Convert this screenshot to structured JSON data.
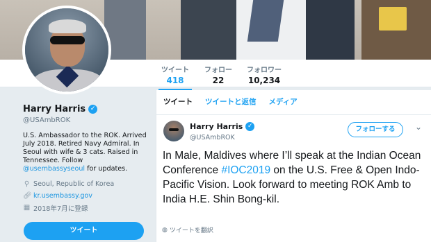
{
  "nav": {
    "stats": [
      {
        "label": "ツイート",
        "value": "418"
      },
      {
        "label": "フォロー",
        "value": "22"
      },
      {
        "label": "フォロワー",
        "value": "10,234"
      }
    ]
  },
  "profile": {
    "name": "Harry Harris",
    "handle": "@USAmbROK",
    "bio_text": "U.S. Ambassador to the ROK. Arrived July 2018. Retired Navy Admiral. In Seoul with wife & 3 cats. Raised in Tennessee. Follow ",
    "bio_link": "@usembassyseoul",
    "bio_end": " for updates.",
    "location": "Seoul, Republic of Korea",
    "website": "kr.usembassy.gov",
    "joined": "2018年7月に登録",
    "tweet_button": "ツイート"
  },
  "timeline": {
    "tabs": [
      "ツイート",
      "ツイートと返信",
      "メディア"
    ],
    "tweet": {
      "name": "Harry Harris",
      "handle": "@USAmbROK",
      "follow_label": "フォローする",
      "text_before": "In Male, Maldives where I’ll speak at the Indian Ocean Conference ",
      "hashtag": "#IOC2019",
      "text_after": " on the U.S. Free & Open Indo-Pacific Vision. Look forward to meeting ROK Amb to India H.E. Shin Bong-kil.",
      "translate_label": "ツイートを翻訳"
    }
  },
  "colors": {
    "accent": "#1da1f2",
    "link": "#1b95e0",
    "muted": "#657786"
  },
  "icons": {
    "verified": "verified-badge-icon",
    "location": "location-pin-icon",
    "link": "link-icon",
    "calendar": "calendar-icon",
    "globe": "globe-icon",
    "caret": "chevron-down-icon"
  }
}
